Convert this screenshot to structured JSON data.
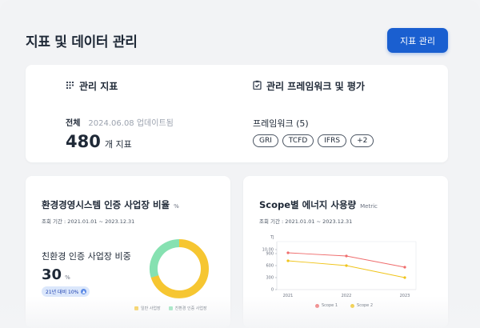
{
  "header": {
    "title": "지표 및 데이터 관리",
    "button_label": "지표 관리"
  },
  "indicators": {
    "section_title": "관리 지표",
    "total_label": "전체",
    "updated_text": "2024.06.08 업데이트됨",
    "count": "480",
    "count_unit": "개 지표"
  },
  "frameworks": {
    "section_title": "관리 프레임워크 및 평가",
    "label": "프레임워크 (5)",
    "chips": [
      "GRI",
      "TCFD",
      "IFRS",
      "+2"
    ]
  },
  "ems_card": {
    "title": "환경경영시스템 인증 사업장 비율",
    "unit": "%",
    "period": "조회 기간 : 2021.01.01 ~ 2023.12.31",
    "ratio_label": "친환경 인증 사업장 비중",
    "ratio_value": "30",
    "ratio_unit": "%",
    "delta_text": "21년 대비 10%",
    "delta_icon": "arrow-up-icon",
    "legend": [
      {
        "label": "일반 사업장",
        "color": "#f6c631"
      },
      {
        "label": "친환경 인증 사업장",
        "color": "#86e1b1"
      }
    ]
  },
  "energy_card": {
    "title": "Scope별 에너지 사용량",
    "unit": "Metric",
    "period": "조회 기간 : 2021.01.01 ~ 2023.12.31"
  },
  "chart_data": [
    {
      "type": "pie",
      "categories": [
        "일반 사업장",
        "친환경 인증 사업장"
      ],
      "values": [
        70,
        30
      ],
      "colors": [
        "#f6c631",
        "#86e1b1"
      ],
      "donut": true,
      "legend_position": "bottom"
    },
    {
      "type": "line",
      "x": [
        "2021",
        "2022",
        "2023"
      ],
      "ylabel": "TJ",
      "yticks": [
        "0",
        "300",
        "600",
        "900",
        "10,00"
      ],
      "ylim": [
        0,
        1200
      ],
      "grid": false,
      "series": [
        {
          "name": "Scope 1",
          "values": [
            920,
            840,
            560
          ],
          "color": "#ef6c6c"
        },
        {
          "name": "Scope 2",
          "values": [
            720,
            600,
            300
          ],
          "color": "#f0c419"
        }
      ],
      "legend_position": "bottom"
    }
  ],
  "icons": {
    "indicators": "grid-icon",
    "frameworks": "clipboard-check-icon"
  }
}
